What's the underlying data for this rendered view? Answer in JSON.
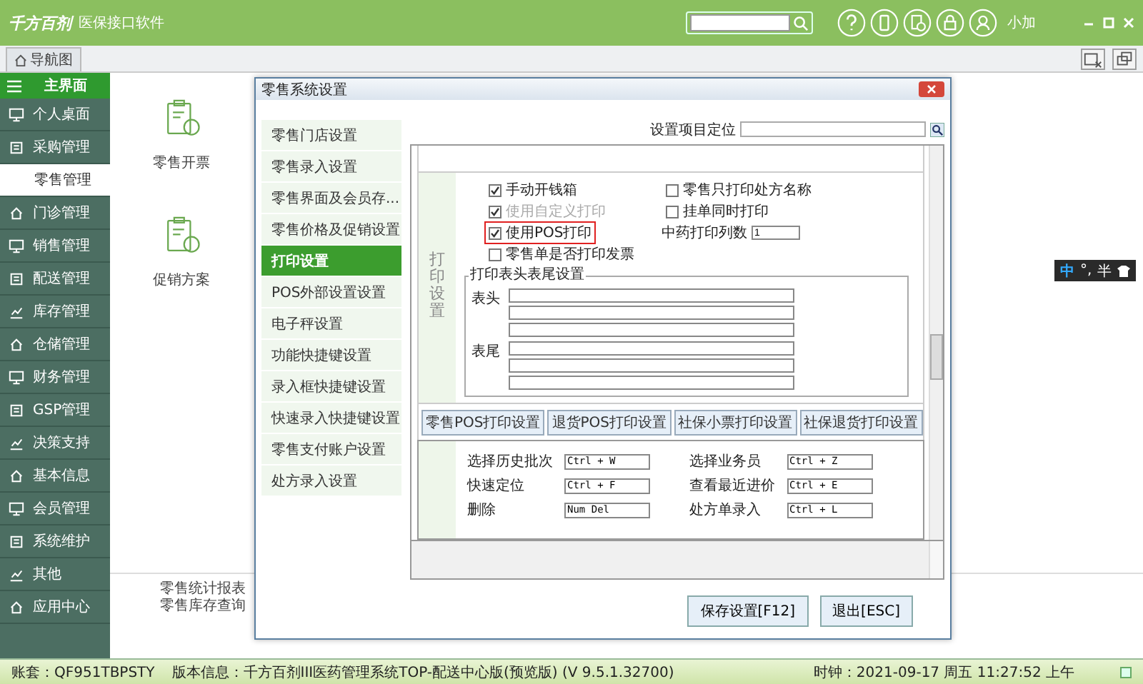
{
  "header": {
    "logo": "千方百剂",
    "product": "医保接口软件",
    "user": "小加"
  },
  "tabs": [
    {
      "label": "导航图",
      "selected": true
    }
  ],
  "sidebar": {
    "title": "主界面",
    "items": [
      {
        "label": "个人桌面",
        "selected": false
      },
      {
        "label": "采购管理",
        "selected": false
      },
      {
        "label": "零售管理",
        "selected": true
      },
      {
        "label": "门诊管理",
        "selected": false
      },
      {
        "label": "销售管理",
        "selected": false
      },
      {
        "label": "配送管理",
        "selected": false
      },
      {
        "label": "库存管理",
        "selected": false
      },
      {
        "label": "仓储管理",
        "selected": false
      },
      {
        "label": "财务管理",
        "selected": false
      },
      {
        "label": "GSP管理",
        "selected": false
      },
      {
        "label": "决策支持",
        "selected": false
      },
      {
        "label": "基本信息",
        "selected": false
      },
      {
        "label": "会员管理",
        "selected": false
      },
      {
        "label": "系统维护",
        "selected": false
      },
      {
        "label": "其他",
        "selected": false
      },
      {
        "label": "应用中心",
        "selected": false
      }
    ]
  },
  "main": {
    "tiles": [
      "零售开票",
      "促销方案"
    ],
    "links": [
      "零售统计报表",
      "零售库存查询"
    ]
  },
  "dialog": {
    "title": "零售系统设置",
    "nav": [
      {
        "label": "零售门店设置",
        "selected": false
      },
      {
        "label": "零售录入设置",
        "selected": false
      },
      {
        "label": "零售界面及会员存...",
        "selected": false
      },
      {
        "label": "零售价格及促销设置",
        "selected": false
      },
      {
        "label": "打印设置",
        "selected": true
      },
      {
        "label": "POS外部设置设置",
        "selected": false
      },
      {
        "label": "电子秤设置",
        "selected": false
      },
      {
        "label": "功能快捷键设置",
        "selected": false
      },
      {
        "label": "录入框快捷键设置",
        "selected": false
      },
      {
        "label": "快速录入快捷键设置",
        "selected": false
      },
      {
        "label": "零售支付账户设置",
        "selected": false
      },
      {
        "label": "处方录入设置",
        "selected": false
      }
    ],
    "locate_label": "设置项目定位",
    "section_title": "打印设置",
    "options": [
      {
        "kind": "checkbox",
        "label": "手动开钱箱",
        "checked": true,
        "disabled": false,
        "highlighted": false
      },
      {
        "kind": "checkbox",
        "label": "零售只打印处方名称",
        "checked": false,
        "disabled": false,
        "highlighted": false
      },
      {
        "kind": "checkbox",
        "label": "使用自定义打印",
        "checked": true,
        "disabled": true,
        "highlighted": false
      },
      {
        "kind": "checkbox",
        "label": "挂单同时打印",
        "checked": false,
        "disabled": false,
        "highlighted": false
      },
      {
        "kind": "checkbox",
        "label": "使用POS打印",
        "checked": true,
        "disabled": false,
        "highlighted": true
      },
      {
        "kind": "number",
        "label": "中药打印列数",
        "value": "1"
      },
      {
        "kind": "checkbox",
        "label": "零售单是否打印发票",
        "checked": false,
        "disabled": false,
        "highlighted": false
      }
    ],
    "group_title": "打印表头表尾设置",
    "header_label": "表头",
    "footer_label": "表尾",
    "print_buttons": [
      "零售POS打印设置",
      "退货POS打印设置",
      "社保小票打印设置",
      "社保退货打印设置"
    ],
    "shortcuts": [
      {
        "label": "选择历史批次",
        "value": "Ctrl + W"
      },
      {
        "label": "选择业务员",
        "value": "Ctrl + Z"
      },
      {
        "label": "快速定位",
        "value": "Ctrl + F"
      },
      {
        "label": "查看最近进价",
        "value": "Ctrl + E"
      },
      {
        "label": "删除",
        "value": "Num Del"
      },
      {
        "label": "处方单录入",
        "value": "Ctrl + L"
      }
    ],
    "buttons": [
      "保存设置[F12]",
      "退出[ESC]"
    ]
  },
  "ime": {
    "mode": "中",
    "punct": "°,",
    "width": "半"
  },
  "status_bar": {
    "account": "账套：QF951TBPSTY",
    "version": "版本信息：千方百剂III医药管理系统TOP-配送中心版(预览版)  (V 9.5.1.32700)",
    "clock": "时钟：2021-09-17 周五 11:27:52 上午"
  }
}
